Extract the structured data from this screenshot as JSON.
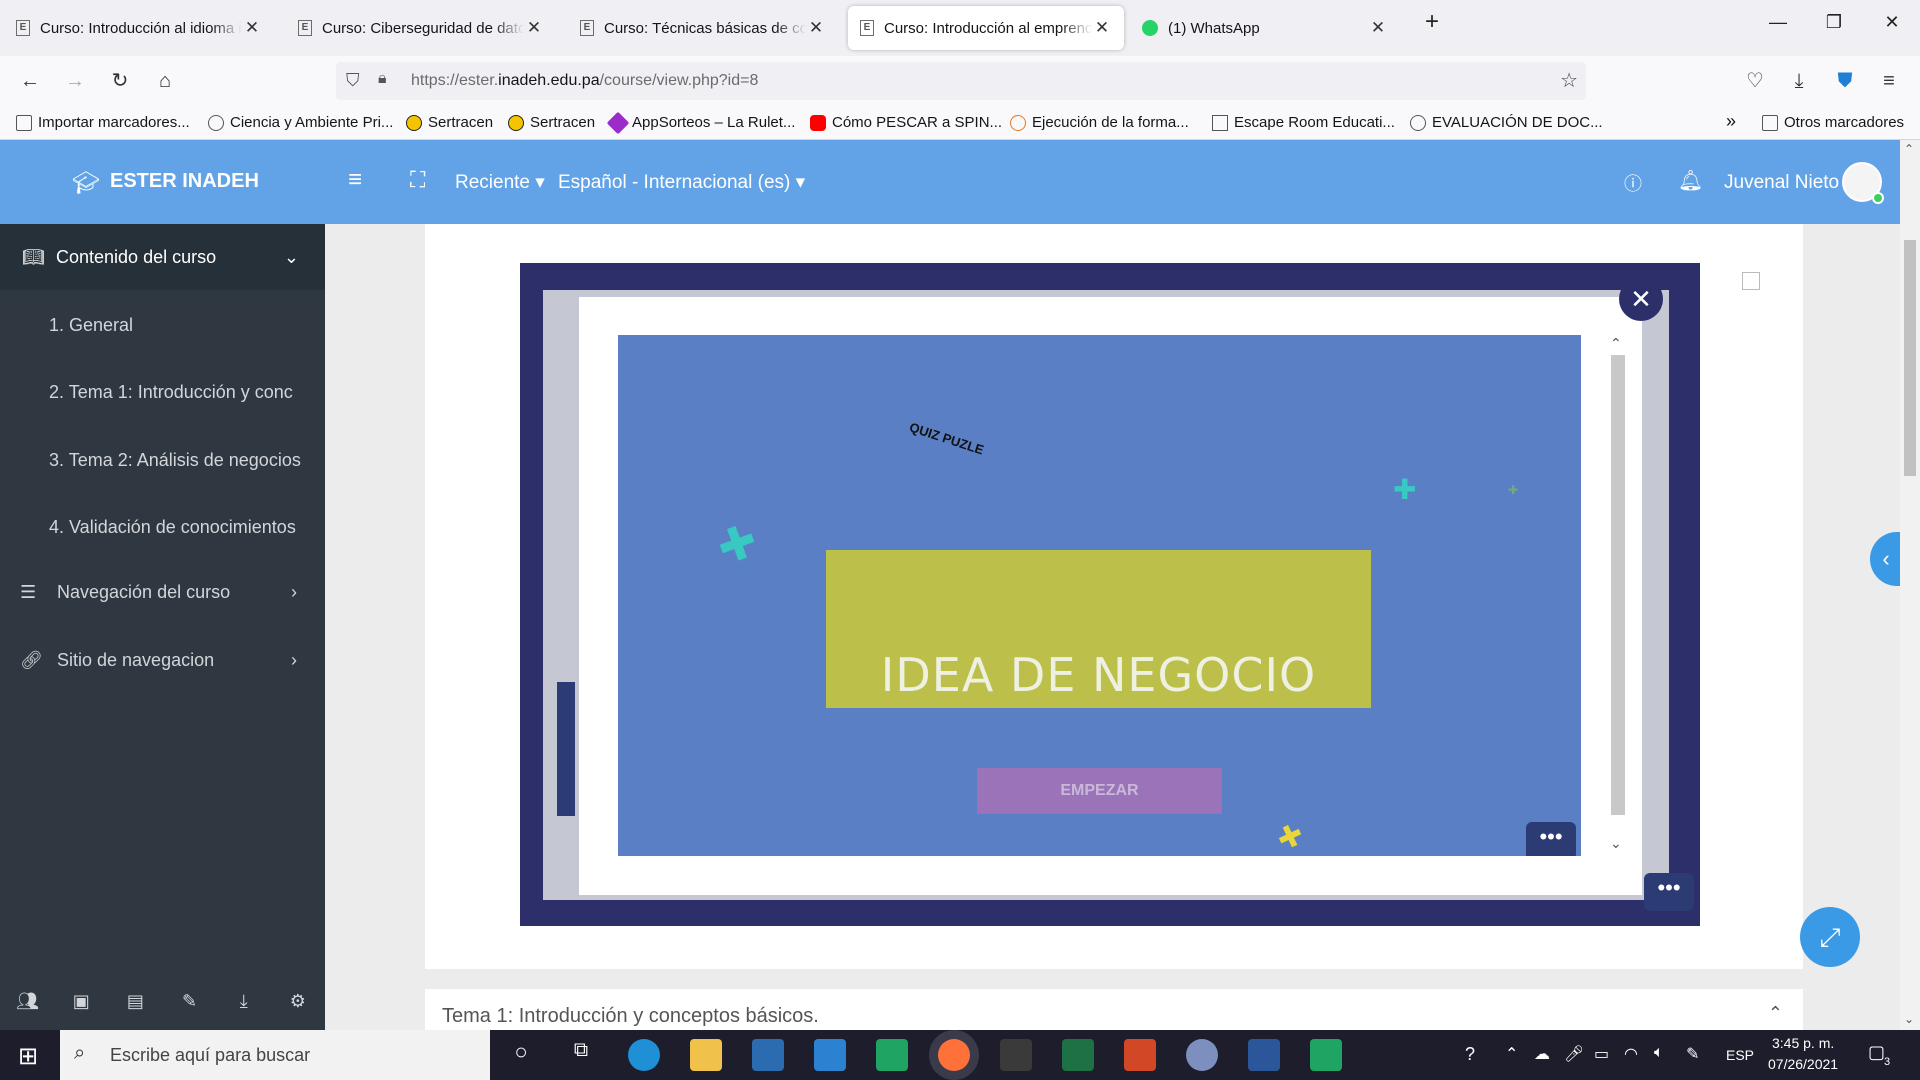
{
  "browser": {
    "tabs": [
      {
        "title": "Curso: Introducción al idioma in",
        "active": false
      },
      {
        "title": "Curso: Ciberseguridad de datos",
        "active": false
      },
      {
        "title": "Curso: Técnicas básicas de coci",
        "active": false
      },
      {
        "title": "Curso: Introducción al emprend",
        "active": true
      },
      {
        "title": "(1) WhatsApp",
        "active": false
      }
    ],
    "url_prefix": "https://ester.",
    "url_host": "inadeh.edu.pa",
    "url_path": "/course/view.php?id=8",
    "bookmarks": [
      "Importar marcadores...",
      "Ciencia y Ambiente Pri...",
      "Sertracen",
      "Sertracen",
      "AppSorteos – La Rulet...",
      "Cómo PESCAR a SPIN...",
      "Ejecución de la forma...",
      "Escape Room Educati...",
      "EVALUACIÓN DE DOC..."
    ],
    "other_bookmarks": "Otros marcadores"
  },
  "site": {
    "brand": "ESTER INADEH",
    "recent_menu": "Reciente",
    "language_menu": "Español - Internacional (es)",
    "user_name": "Juvenal Nieto",
    "colors": {
      "header": "#61a3e6",
      "drawer": "#2f3840",
      "accent": "#3b9ae6"
    }
  },
  "drawer": {
    "header": "Contenido del curso",
    "items": [
      "1. General",
      "2. Tema 1: Introducción y conc",
      "3. Tema 2: Análisis de negocios",
      "4. Validación de conocimientos"
    ],
    "nav_course": "Navegación del curso",
    "site_nav": "Sitio de navegacion"
  },
  "activity": {
    "logo_text": "QUIZ PUZLE",
    "title": "IDEA DE NEGOCIO",
    "start_button": "EMPEZAR",
    "colors": {
      "background": "#5b7fc4",
      "title_box": "#bcbf4a",
      "button": "#9b73b8"
    }
  },
  "section": {
    "title": "Tema 1: Introducción y conceptos básicos."
  },
  "taskbar": {
    "search_placeholder": "Escribe aquí para buscar",
    "language": "ESP",
    "time": "3:45 p. m.",
    "date": "07/26/2021",
    "notifications": "3"
  }
}
